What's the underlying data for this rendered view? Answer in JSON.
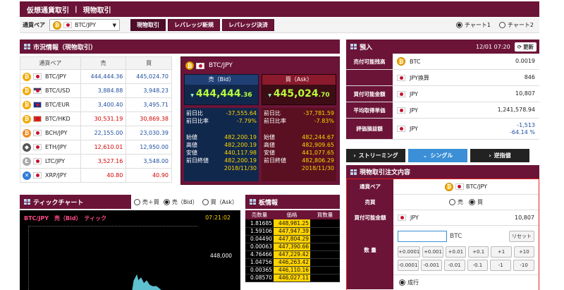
{
  "topbar": {
    "section": "仮想通貨取引",
    "page": "現物取引"
  },
  "subbar": {
    "pair_label": "通貨ペア",
    "pair_value": "BTC/JPY",
    "tabs": [
      "現物取引",
      "レバレッジ新規",
      "レバレッジ決済"
    ],
    "chart_options": [
      "チャート1",
      "チャート2"
    ]
  },
  "market": {
    "title": "市況情報（現物取引）",
    "headers": [
      "通貨ペア",
      "売",
      "買"
    ],
    "rows": [
      {
        "pair": "BTC/JPY",
        "sell": "444,444.36",
        "buy": "445,024.70",
        "coin": "₿",
        "coin_color": "#f2a900",
        "flag": "jp",
        "sell_color": "blue",
        "buy_color": "blue"
      },
      {
        "pair": "BTC/USD",
        "sell": "3,884.88",
        "buy": "3,948.23",
        "coin": "₿",
        "coin_color": "#f2a900",
        "flag": "us",
        "sell_color": "blue",
        "buy_color": "blue"
      },
      {
        "pair": "BTC/EUR",
        "sell": "3,400.40",
        "buy": "3,495.71",
        "coin": "₿",
        "coin_color": "#f2a900",
        "flag": "eu",
        "sell_color": "blue",
        "buy_color": "blue"
      },
      {
        "pair": "BTC/HKD",
        "sell": "30,531.19",
        "buy": "30,869.38",
        "coin": "₿",
        "coin_color": "#f2a900",
        "flag": "hk",
        "sell_color": "red",
        "buy_color": "red"
      },
      {
        "pair": "BCH/JPY",
        "sell": "22,155.00",
        "buy": "23,030.39",
        "coin": "₿",
        "coin_color": "#f08a24",
        "flag": "jp",
        "sell_color": "blue",
        "buy_color": "blue"
      },
      {
        "pair": "ETH/JPY",
        "sell": "12,610.01",
        "buy": "12,950.00",
        "coin": "◆",
        "coin_color": "#555555",
        "flag": "jp",
        "sell_color": "red",
        "buy_color": "blue"
      },
      {
        "pair": "LTC/JPY",
        "sell": "3,527.16",
        "buy": "3,548.00",
        "coin": "Ł",
        "coin_color": "#aaaaaa",
        "flag": "jp",
        "sell_color": "red",
        "buy_color": "blue"
      },
      {
        "pair": "XRP/JPY",
        "sell": "40.80",
        "buy": "40.90",
        "coin": "✕",
        "coin_color": "#2e7bd6",
        "flag": "jp",
        "sell_color": "red",
        "buy_color": "red"
      }
    ]
  },
  "quote": {
    "pair": "BTC/JPY",
    "bid_label": "売（Bid）",
    "ask_label": "買（Ask）",
    "bid_main": "444,444",
    "bid_dec": ".36",
    "ask_main": "445,024",
    "ask_dec": ".70",
    "stat_labels": [
      "前日比",
      "前日比率",
      "始値",
      "高値",
      "安値",
      "前日終値"
    ],
    "bid_stats": [
      "-37,555.64",
      "-7.79%",
      "482,200.19",
      "482,200.19",
      "440,117.98",
      "482,200.19"
    ],
    "ask_stats": [
      "-37,781.59",
      "-7.83%",
      "482,244.67",
      "482,909.65",
      "441,077.65",
      "482,806.29"
    ],
    "date": "2018/11/30"
  },
  "tick": {
    "title": "ティックチャート",
    "options": [
      "売＋買",
      "売（Bid）",
      "買（Ask）"
    ],
    "chart_header": "BTC/JPY　売（Bid）　ティック",
    "time": "07:21:02",
    "level": "448,000"
  },
  "orderbook": {
    "title": "板情報",
    "headers": [
      "売数量",
      "価格",
      "買数量"
    ],
    "rows": [
      {
        "qty": "1.81685",
        "price": "448,981.25"
      },
      {
        "qty": "1.59106",
        "price": "447,947.39"
      },
      {
        "qty": "0.04490",
        "price": "447,804.29"
      },
      {
        "qty": "0.00063",
        "price": "447,390.66"
      },
      {
        "qty": "4.76466",
        "price": "447,229.42"
      },
      {
        "qty": "1.04756",
        "price": "446,263.42"
      },
      {
        "qty": "0.00365",
        "price": "446,110.16"
      },
      {
        "qty": "0.08570",
        "price": "446,027.11"
      }
    ]
  },
  "account": {
    "title": "預入",
    "datetime": "12/01 07:20",
    "refresh": "更新",
    "rows": [
      {
        "label": "売付可能残高",
        "asset": "BTC",
        "value": "0.0019",
        "value2": "",
        "icon": "coin"
      },
      {
        "label": "",
        "asset": "JPY換算",
        "value": "846",
        "value2": "",
        "icon": "jp"
      },
      {
        "label": "買付可能金額",
        "asset": "JPY",
        "value": "10,807",
        "value2": "",
        "icon": "jp"
      },
      {
        "label": "平均取得単価",
        "asset": "JPY",
        "value": "1,241,578.94",
        "value2": "",
        "icon": "jp"
      },
      {
        "label": "評価損益額",
        "asset": "JPY",
        "value": "-1,513",
        "value2": "-64.14 %",
        "icon": "jp"
      }
    ]
  },
  "modes": [
    "ストリーミング",
    "シングル",
    "逆指値"
  ],
  "order": {
    "title": "現物取引注文内容",
    "pair_label": "通貨ペア",
    "pair_value": "BTC/JPY",
    "side_label": "売買",
    "side_options": [
      "売",
      "買"
    ],
    "funds_label": "買付可能金額",
    "funds_asset": "JPY",
    "funds_value": "10,807",
    "qty_label": "数 量",
    "qty_unit": "BTC",
    "reset": "リセット",
    "plus_steps": [
      "+0.0001",
      "+0.001",
      "+0.01",
      "+0.1",
      "+1",
      "+10"
    ],
    "minus_steps": [
      "-0.0001",
      "-0.001",
      "-0.01",
      "-0.1",
      "-1",
      "-10"
    ],
    "exec_option": "成行"
  }
}
